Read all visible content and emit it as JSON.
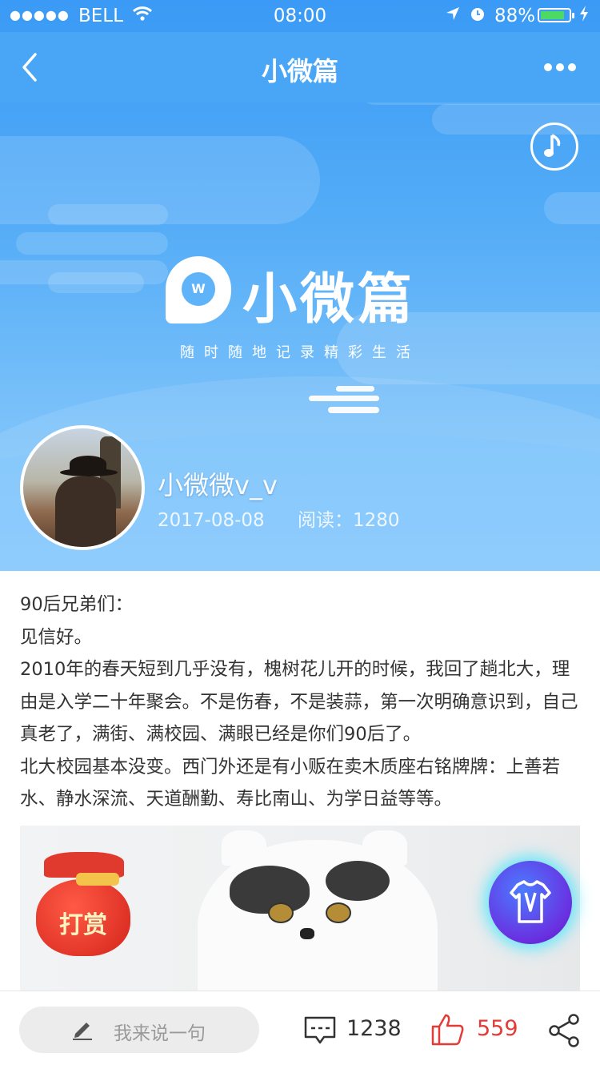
{
  "status_bar": {
    "signal": "●●●●●",
    "carrier": "BELL",
    "time": "08:00",
    "battery_pct": "88%",
    "battery_level": 0.88
  },
  "nav": {
    "title": "小微篇"
  },
  "banner": {
    "logo_text": "小微篇",
    "logo_mark": "W",
    "slogan": "随时随地记录精彩生活"
  },
  "author": {
    "name": "小微微v_v",
    "date": "2017-08-08",
    "reads": "阅读：1280"
  },
  "article": {
    "paragraphs": [
      "90后兄弟们：",
      "见信好。",
      "2010年的春天短到几乎没有，槐树花儿开的时候，我回了趟北大，理由是入学二十年聚会。不是伤春，不是装蒜，第一次明确意识到，自己真老了，满街、满校园、满眼已经是你们90后了。",
      "北大校园基本没变。西门外还是有小贩在卖木质座右铭牌牌：上善若水、静水深流、天道酬勤、寿比南山、为学日益等等。"
    ]
  },
  "reward": {
    "label": "打赏"
  },
  "bottom_bar": {
    "comment_placeholder": "我来说一句",
    "comment_count": "1238",
    "like_count": "559"
  },
  "colors": {
    "nav_blue": "#49a6f6",
    "like_red": "#e33b35",
    "battery_green": "#4cd964"
  },
  "icons": [
    "back-icon",
    "more-icon",
    "music-icon",
    "wifi-icon",
    "location-icon",
    "alarm-icon",
    "battery-icon",
    "pen-icon",
    "comment-icon",
    "like-icon",
    "share-icon",
    "tee-icon"
  ]
}
